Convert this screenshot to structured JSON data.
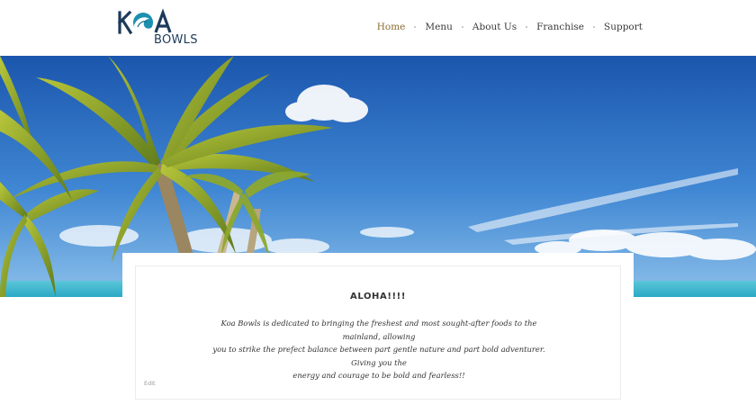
{
  "brand": {
    "logo_text_top": "KOA",
    "logo_text_bottom": "BOWLS",
    "colors": {
      "navy": "#1d3a5a",
      "teal": "#1b8fb0"
    }
  },
  "nav": {
    "items": [
      {
        "label": "Home",
        "active": true
      },
      {
        "label": "Menu",
        "active": false
      },
      {
        "label": "About Us",
        "active": false
      },
      {
        "label": "Franchise",
        "active": false
      },
      {
        "label": "Support",
        "active": false
      }
    ],
    "colors": {
      "active": "#8a6d2f",
      "default": "#3a3a3a"
    }
  },
  "hero": {
    "image": "tropical-beach-palm-trees",
    "colors": {
      "sky_top": "#1f5fb8",
      "sky_bottom": "#7fb7e8",
      "sea": "#35b7cf"
    }
  },
  "content": {
    "title": "ALOHA!!!!",
    "lines": [
      "Koa Bowls is dedicated to bringing the freshest and most sought-after foods to the mainland, allowing",
      "you to strike the prefect balance between part gentle nature and part bold adventurer. Giving you the",
      "energy and courage to be bold and fearless!!"
    ],
    "edit_label": "Edit"
  }
}
